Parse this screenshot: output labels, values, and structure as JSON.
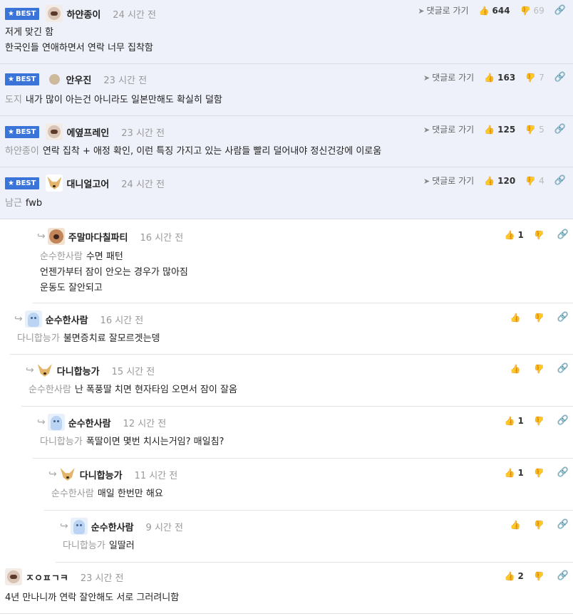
{
  "labels": {
    "best": "BEST",
    "goto_reply": "댓글로 가기"
  },
  "icons": {
    "thumb_up": "thumbs-up-icon",
    "thumb_down": "thumbs-down-icon",
    "link": "link-icon",
    "reply_arrow": "reply-arrow-icon",
    "send": "send-arrow-icon"
  },
  "colors": {
    "best_bg": "#eef1fa",
    "badge": "#3b74d9",
    "mention": "#999999"
  },
  "comments": [
    {
      "best": true,
      "nick": "하얀종이",
      "time": "24 시간 전",
      "mention": "",
      "lines": [
        "저게 맞긴 함",
        "한국인들 연애하면서 연락 너무 집착함"
      ],
      "up": "644",
      "down": "69"
    },
    {
      "best": true,
      "nick": "안우진",
      "time": "23 시간 전",
      "mention": "도지",
      "lines": [
        "내가 많이 아는건 아니라도 일본만해도 확실히 덜함"
      ],
      "up": "163",
      "down": "7"
    },
    {
      "best": true,
      "nick": "에옆프레인",
      "time": "23 시간 전",
      "mention": "하얀종이",
      "lines": [
        "연락 집착 + 애정 확인, 이런 특징 가지고 있는 사람들 빨리 덜어내야 정신건강에 이로움"
      ],
      "up": "125",
      "down": "5"
    },
    {
      "best": true,
      "nick": "대니얼고어",
      "time": "24 시간 전",
      "mention": "남근",
      "lines": [
        "fwb"
      ],
      "up": "120",
      "down": "4"
    },
    {
      "best": false,
      "nick": "주말마다칠파티",
      "time": "16 시간 전",
      "mention": "순수한사람",
      "lines": [
        "수면 패턴",
        "언젠가부터 잠이 안오는 경우가 많아짐",
        "운동도 잘안되고"
      ],
      "up": "1",
      "down": ""
    },
    {
      "best": false,
      "nick": "순수한사람",
      "time": "16 시간 전",
      "mention": "다니합능가",
      "lines": [
        "불면증치료 잘모르겟는뎅"
      ],
      "up": "",
      "down": ""
    },
    {
      "best": false,
      "nick": "다니합능가",
      "time": "15 시간 전",
      "mention": "순수한사람",
      "lines": [
        "난 폭풍딸 치면 현자타임 오면서 잠이 잘옴"
      ],
      "up": "",
      "down": ""
    },
    {
      "best": false,
      "nick": "순수한사람",
      "time": "12 시간 전",
      "mention": "다니합능가",
      "lines": [
        "폭딸이면 몇번 치시는거임? 매일침?"
      ],
      "up": "1",
      "down": ""
    },
    {
      "best": false,
      "nick": "다니합능가",
      "time": "11 시간 전",
      "mention": "순수한사람",
      "lines": [
        "매일 한번만 해요"
      ],
      "up": "1",
      "down": ""
    },
    {
      "best": false,
      "nick": "순수한사람",
      "time": "9 시간 전",
      "mention": "다니합능가",
      "lines": [
        "일딸러"
      ],
      "up": "",
      "down": ""
    },
    {
      "best": false,
      "nick": "ㅈㅇㅍㄱㅋ",
      "time": "23 시간 전",
      "mention": "",
      "lines": [
        "4년 만나니까 연락 잘안해도 서로 그러려니함"
      ],
      "up": "2",
      "down": ""
    }
  ]
}
